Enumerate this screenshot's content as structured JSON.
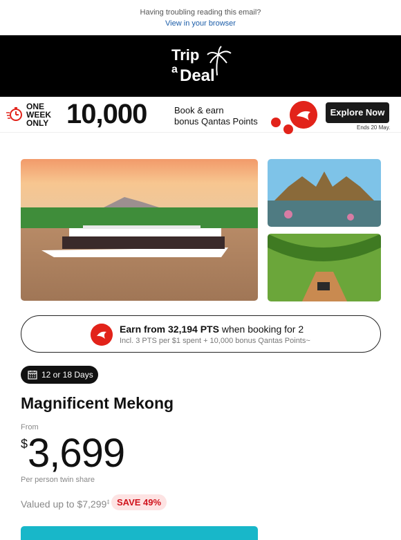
{
  "preheader": {
    "question": "Having troubling reading this email?",
    "link": "View in your browser"
  },
  "brand": {
    "line1": "Trip",
    "line2": "a",
    "line3": "Deal"
  },
  "promo": {
    "one_week": [
      "ONE",
      "WEEK",
      "ONLY"
    ],
    "big_number": "10,000",
    "book_line1": "Book & earn",
    "book_line2": "bonus Qantas Points",
    "badge_text": "QANTAS POINTS",
    "cta": "Explore Now",
    "ends": "Ends 20 May."
  },
  "earn": {
    "strong": "Earn from 32,194 PTS",
    "rest": " when booking for 2",
    "sub": "Incl. 3 PTS per $1 spent + 10,000 bonus Qantas Points~"
  },
  "deal": {
    "duration": "12 or 18 Days",
    "title": "Magnificent Mekong",
    "from": "From",
    "currency": "$",
    "price": "3,699",
    "per_person": "Per person twin share",
    "valued": "Valued up to $7,299",
    "valued_mark": "‡",
    "save": "SAVE 49%"
  },
  "colors": {
    "accent_red": "#e2231a",
    "cta_teal": "#18b7c9",
    "save_bg": "#fde3e3"
  }
}
